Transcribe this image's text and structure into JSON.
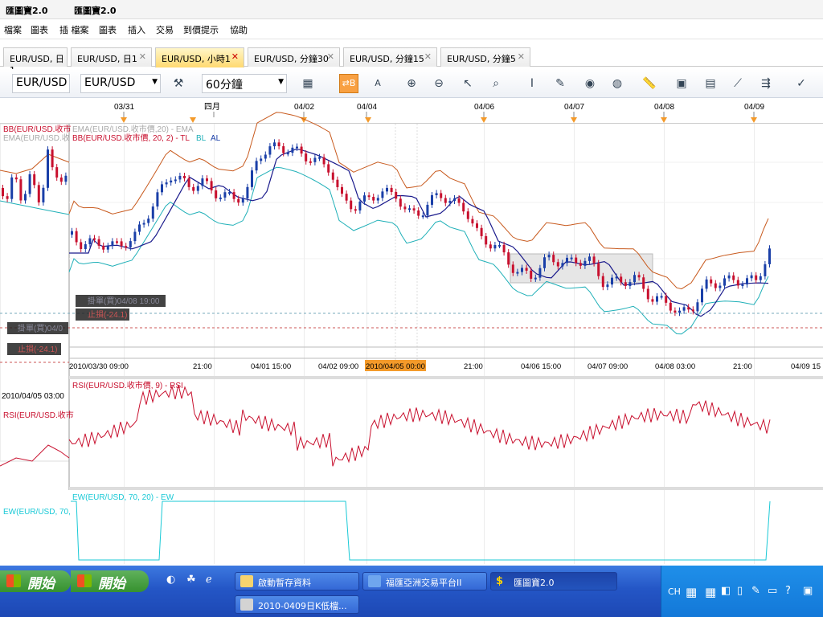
{
  "app": {
    "title": "匯圖寶2.0",
    "title2": "匯圖寶2.0"
  },
  "menu": [
    "檔案",
    "圖表",
    "插 檔案",
    "圖表",
    "插入",
    "交易",
    "到價提示",
    "協助"
  ],
  "tabs": [
    {
      "label": "EUR/USD, 日1",
      "closable": false
    },
    {
      "label": "EUR/USD, 日1",
      "closable": true
    },
    {
      "label": "EUR/USD, 小時1",
      "closable": true,
      "active": true
    },
    {
      "label": "EUR/USD, 分鐘30",
      "closable": true
    },
    {
      "label": "EUR/USD, 分鐘15",
      "closable": true
    },
    {
      "label": "EUR/USD, 分鐘5",
      "closable": true
    }
  ],
  "toolbar": {
    "symbol_left": "EUR/USD",
    "symbol": "EUR/USD",
    "period": "60分鐘",
    "button_hl": "⇄B",
    "button_a": "A"
  },
  "chart": {
    "top_dates": [
      "03/31",
      "四月",
      "04/02",
      "04/04",
      "04/06",
      "04/07",
      "04/08",
      "04/09"
    ],
    "bottom_dates": [
      "2010/03/30 09:00",
      "21:00",
      "04/01 15:00",
      "04/02 09:00",
      "2010/04/05 00:00",
      "21:00",
      "04/06 15:00",
      "04/07 09:00",
      "04/08 03:00",
      "21:00",
      "04/09 15"
    ],
    "left_date": "2010/04/05 03:00",
    "legend_bb": "BB(EUR/USD.收市",
    "legend_ema_left": "EMA(EUR/USD.收",
    "legend_ema": "EMA(EUR/USD.收市價,20) - EMA",
    "legend_bb_full": "BB(EUR/USD.收市價, 20, 2) - TL",
    "legend_bb_tags": [
      "BL",
      "AL"
    ],
    "order_label_1": "掛單(買)04/08 19:00",
    "order_label_2": "止損(-24.1)",
    "order_label_left_1": "掛單(買)04/0",
    "order_label_left_2": "止損(-24.1)",
    "rsi_legend": "RSI(EUR/USD.收市價, 9) - RSI",
    "rsi_legend_left": "RSI(EUR/USD.收市",
    "ew_legend": "EW(EUR/USD, 70, 20) - EW",
    "ew_legend_left": "EW(EUR/USD, 70,",
    "colors": {
      "up": "#1a3fa8",
      "down": "#c8102e",
      "bb": "#c85a1e",
      "bbl": "#20b0b8",
      "ema": "#1a1a8c",
      "rsi": "#c8102e",
      "ew": "#19c9d6",
      "hl_date": "#f49a2a"
    }
  },
  "taskbar": {
    "start": "開始",
    "items": [
      "啟動暫存資料",
      "福匯亞洲交易平台II",
      "匯圖寶2.0",
      "2010-0409日K低檔..."
    ],
    "tray": [
      "CH"
    ]
  }
}
